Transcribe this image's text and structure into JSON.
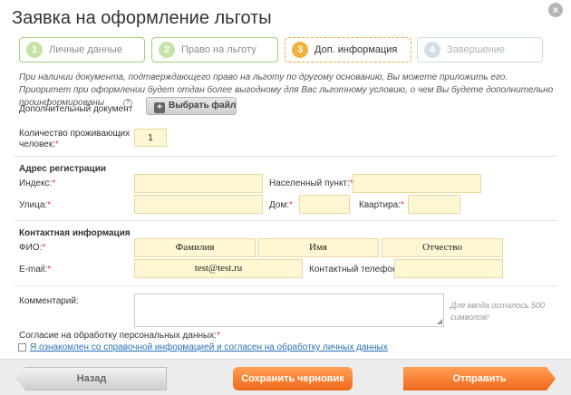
{
  "dialog": {
    "title": "Заявка на оформление льготы",
    "close_label": "×"
  },
  "steps": [
    {
      "num": "1",
      "label": "Личные данные"
    },
    {
      "num": "2",
      "label": "Право на льготу"
    },
    {
      "num": "3",
      "label": "Доп. информация"
    },
    {
      "num": "4",
      "label": "Завершение"
    }
  ],
  "info_text": "При наличии документа, подтверждающего право на льготу по другому основанию, Вы можете приложить его. Приоритет при оформлении будет отдан более выгодному для Вас льготному условию, о чем Вы будете дополнительно проинформированы",
  "document": {
    "label": "Дополнительный документ",
    "help": "?",
    "button_icon": "+",
    "button_label": "Выбрать файл"
  },
  "residents": {
    "label_1": "Количество проживающих",
    "label_2": "человек:",
    "req": "*",
    "value": "1"
  },
  "address": {
    "heading": "Адрес регистрации",
    "index_label": "Индекс:",
    "index_value": "",
    "city_label": "Населенный пункт:",
    "city_value": "",
    "street_label": "Улица:",
    "street_value": "",
    "house_label": "Дом:",
    "house_value": "",
    "flat_label": "Квартира:",
    "flat_value": "",
    "req": "*"
  },
  "contact": {
    "heading": "Контактная информация",
    "fio_label": "ФИО:",
    "surname_value": "Фамилия",
    "name_value": "Имя",
    "patronymic_value": "Отчество",
    "email_label": "E-mail:",
    "email_value": "test@test.ru",
    "phone_label": "Контактный телефон:",
    "phone_value": "",
    "req": "*"
  },
  "comment": {
    "label": "Комментарий:",
    "value": "",
    "hint": "Для ввода осталось 500 символов!",
    "grip": "◢"
  },
  "consent": {
    "label": "Согласие на обработку персональных данных:",
    "req": "*",
    "checkbox_label": "Я ознакомлен со справочной информацией и согласен на обработку личных данных"
  },
  "footer": {
    "back_label": "Назад",
    "draft_label": "Сохранить черновик",
    "send_label": "Отправить"
  }
}
